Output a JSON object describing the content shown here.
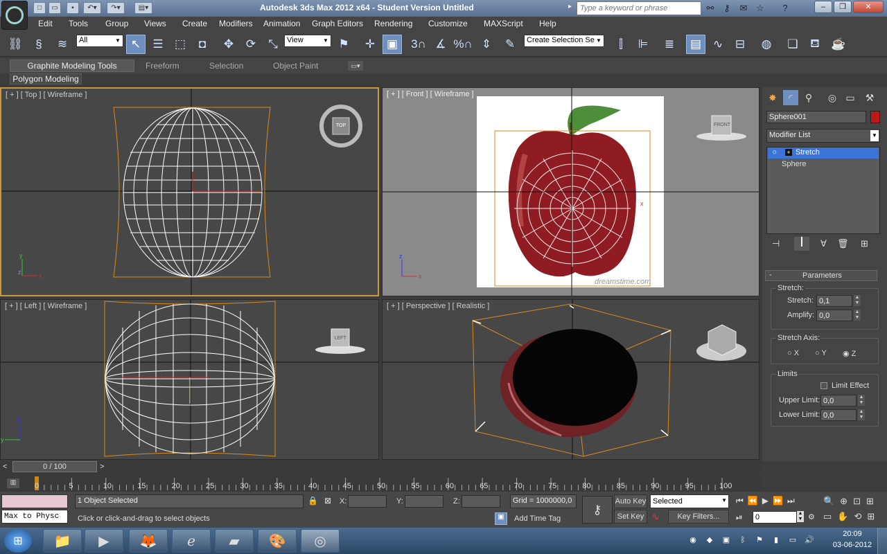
{
  "title": "Autodesk 3ds Max  2012 x64  - Student Version    Untitled",
  "search_placeholder": "Type a keyword or phrase",
  "menus": [
    "Edit",
    "Tools",
    "Group",
    "Views",
    "Create",
    "Modifiers",
    "Animation",
    "Graph Editors",
    "Rendering",
    "Customize",
    "MAXScript",
    "Help"
  ],
  "toolbar": {
    "filter": "All",
    "ref_coord": "View",
    "named_sel": "Create Selection Se",
    "snap_angle": "3",
    "percent": "%"
  },
  "ribbon": {
    "tabs": [
      "Graphite Modeling Tools",
      "Freeform",
      "Selection",
      "Object Paint"
    ],
    "sub": "Polygon Modeling"
  },
  "viewports": {
    "top": "[ + ] [ Top ] [ Wireframe ]",
    "front": "[ + ] [ Front ] [ Wireframe ]",
    "left": "[ + ] [ Left ] [ Wireframe ]",
    "persp": "[ + ] [ Perspective ] [ Realistic ]",
    "cube_top": "TOP",
    "cube_front": "FRONT",
    "cube_left": "LEFT",
    "watermark": "dreamstime.com"
  },
  "command_panel": {
    "object_name": "Sphere001",
    "object_color": "#c01818",
    "modifier_list": "Modifier List",
    "stack": [
      "Stretch",
      "Sphere"
    ],
    "rollout": "Parameters",
    "stretch_group": "Stretch:",
    "stretch_label": "Stretch:",
    "stretch_value": "0,1",
    "amplify_label": "Amplify:",
    "amplify_value": "0,0",
    "axis_group": "Stretch Axis:",
    "axes": [
      "X",
      "Y",
      "Z"
    ],
    "axis_selected": "Z",
    "limits_group": "Limits",
    "limit_effect": "Limit Effect",
    "upper_label": "Upper Limit:",
    "upper_value": "0,0",
    "lower_label": "Lower Limit:",
    "lower_value": "0,0"
  },
  "timeline": {
    "frame": "0 / 100",
    "ticks": [
      "0",
      "5",
      "10",
      "15",
      "20",
      "25",
      "30",
      "35",
      "40",
      "45",
      "50",
      "55",
      "60",
      "65",
      "70",
      "75",
      "80",
      "85",
      "90",
      "95",
      "100"
    ]
  },
  "status": {
    "maxscript": "Max to Physc",
    "selected": "1 Object Selected",
    "prompt": "Click or click-and-drag to select objects",
    "x_label": "X:",
    "y_label": "Y:",
    "z_label": "Z:",
    "grid": "Grid = 1000000,0",
    "add_time_tag": "Add Time Tag",
    "auto_key": "Auto Key",
    "set_key": "Set Key",
    "key_mode": "Selected",
    "key_filters": "Key Filters...",
    "current_frame": "0"
  },
  "taskbar": {
    "time": "20:09",
    "date": "03-06-2012"
  }
}
